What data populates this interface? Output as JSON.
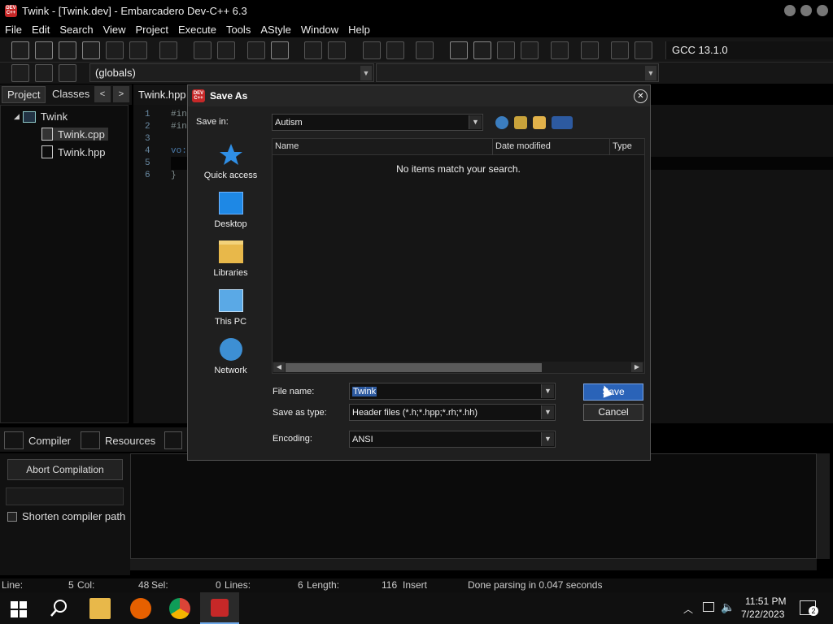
{
  "window": {
    "title": "Twink - [Twink.dev] - Embarcadero Dev-C++ 6.3",
    "logo_text": "DEV C++"
  },
  "menu": [
    "File",
    "Edit",
    "Search",
    "View",
    "Project",
    "Execute",
    "Tools",
    "AStyle",
    "Window",
    "Help"
  ],
  "toolbar": {
    "compiler": "GCC 13.1.0",
    "scope": "(globals)"
  },
  "left_panel": {
    "tabs": [
      "Project",
      "Classes"
    ],
    "tree": {
      "project": "Twink",
      "files": [
        "Twink.cpp",
        "Twink.hpp"
      ]
    }
  },
  "editor": {
    "tab": "Twink.hpp",
    "lines": [
      {
        "n": "1",
        "code": "#in"
      },
      {
        "n": "2",
        "code": "#in"
      },
      {
        "n": "3",
        "code": ""
      },
      {
        "n": "4",
        "code": "vo:"
      },
      {
        "n": "5",
        "code": ""
      },
      {
        "n": "6",
        "code": "}"
      }
    ]
  },
  "bottom_panel": {
    "tabs": [
      "Compiler",
      "Resources"
    ],
    "abort_label": "Abort Compilation",
    "shorten_label": "Shorten compiler path"
  },
  "statusbar": {
    "line_label": "Line:",
    "line_value": "5",
    "col_label": "Col:",
    "col_value": "48",
    "sel_label": "Sel:",
    "sel_value": "0",
    "lines_label": "Lines:",
    "lines_value": "6",
    "length_label": "Length:",
    "length_value": "116",
    "mode": "Insert",
    "message": "Done parsing in 0.047 seconds"
  },
  "taskbar": {
    "time": "11:51 PM",
    "date": "7/22/2023",
    "notification_count": "2"
  },
  "dialog": {
    "title": "Save As",
    "close_glyph": "✕",
    "save_in_label": "Save in:",
    "save_in_value": "Autism",
    "places": [
      "Quick access",
      "Desktop",
      "Libraries",
      "This PC",
      "Network"
    ],
    "columns": [
      "Name",
      "Date modified",
      "Type"
    ],
    "empty_message": "No items match your search.",
    "file_name_label": "File name:",
    "file_name_value": "Twink",
    "save_type_label": "Save as type:",
    "save_type_value": "Header files (*.h;*.hpp;*.rh;*.hh)",
    "encoding_label": "Encoding:",
    "encoding_value": "ANSI",
    "save_label": "Save",
    "cancel_label": "Cancel"
  }
}
